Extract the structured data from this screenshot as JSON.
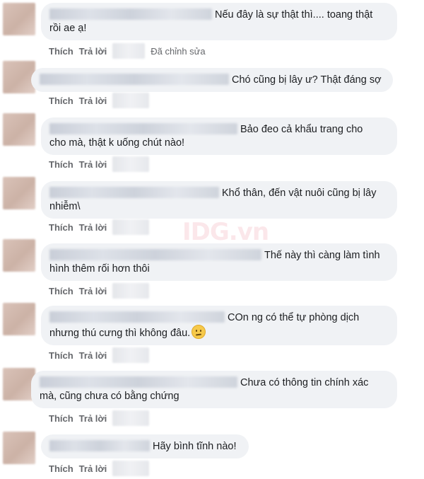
{
  "actions": {
    "like": "Thích",
    "reply": "Trả lời"
  },
  "watermark": "IDG.vn",
  "comments": [
    {
      "line1": "Nếu đây là sự thật thì.... toang thật",
      "line2": "rồi ae ạ!",
      "edited": "Đã chỉnh sửa"
    },
    {
      "line1": "Chó cũng bị lây ư? Thật đáng sợ"
    },
    {
      "line1": "Bảo đeo cả khẩu trang cho",
      "line2": "cho mà, thật k uống chút nào!"
    },
    {
      "line1": "Khổ thân, đến vật nuôi cũng bị lây",
      "line2": "nhiễm\\"
    },
    {
      "line1": "Thế này thì càng làm tình",
      "line2": "hình thêm rối hơn thôi"
    },
    {
      "line1": "COn ng có thể tự phòng dịch",
      "line2": "nhưng thú cưng thì không đâu.",
      "emoji": "worried-face"
    },
    {
      "line1": "Chưa có thông tin chính xác",
      "line2": "mà, cũng chưa có bằng chứng"
    },
    {
      "line1": "Hãy bình tĩnh nào!"
    }
  ]
}
